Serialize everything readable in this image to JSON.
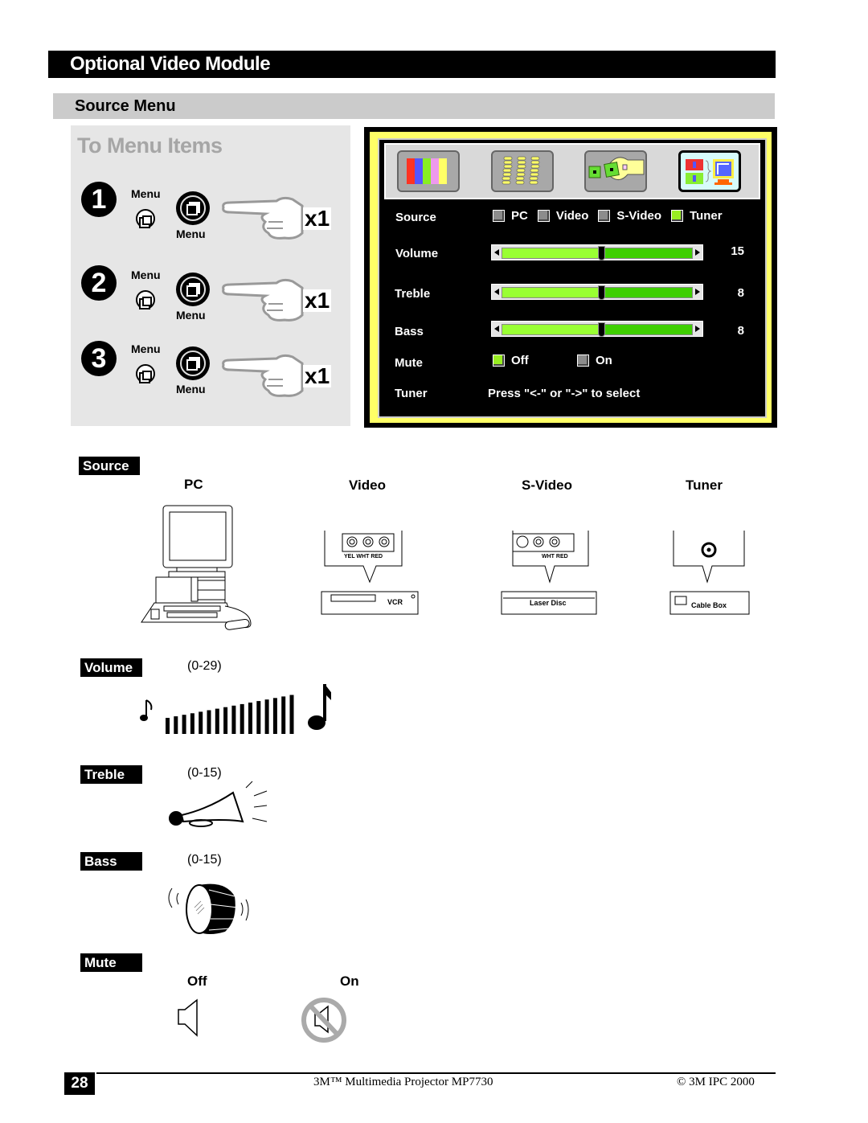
{
  "header": {
    "section_title": "Optional Video Module",
    "subsection_title": "Source Menu"
  },
  "instructions": {
    "title": "To Menu Items",
    "steps": [
      {
        "number": "1",
        "button_label_top": "Menu",
        "button_label_bottom": "Menu",
        "press_count": "x1"
      },
      {
        "number": "2",
        "button_label_top": "Menu",
        "button_label_bottom": "Menu",
        "press_count": "x1"
      },
      {
        "number": "3",
        "button_label_top": "Menu",
        "button_label_bottom": "Menu",
        "press_count": "x1"
      }
    ]
  },
  "osd": {
    "tabs": [
      {
        "icon": "color-bars-icon",
        "active": false
      },
      {
        "icon": "image-adjust-icon",
        "active": false
      },
      {
        "icon": "setup-wrench-icon",
        "active": false
      },
      {
        "icon": "source-select-icon",
        "active": true
      }
    ],
    "source": {
      "label": "Source",
      "options": [
        {
          "label": "PC",
          "selected": false
        },
        {
          "label": "Video",
          "selected": false
        },
        {
          "label": "S-Video",
          "selected": false
        },
        {
          "label": "Tuner",
          "selected": true
        }
      ]
    },
    "sliders": [
      {
        "label": "Volume",
        "value": "15",
        "fraction": 0.52
      },
      {
        "label": "Treble",
        "value": "8",
        "fraction": 0.52
      },
      {
        "label": "Bass",
        "value": "8",
        "fraction": 0.52
      }
    ],
    "mute": {
      "label": "Mute",
      "options": [
        {
          "label": "Off",
          "selected": true
        },
        {
          "label": "On",
          "selected": false
        }
      ]
    },
    "tuner": {
      "label": "Tuner",
      "hint": "Press \"<-\" or \"->\" to select"
    },
    "colors": {
      "frame_yellow": "#ffff66",
      "slider_fill": "#99ff33",
      "slider_track": "#3fcf00",
      "checkbox_on": "#99ee22",
      "checkbox_off": "#8c8c8c"
    }
  },
  "legend": {
    "source": {
      "tag": "Source",
      "items": [
        {
          "heading": "PC",
          "device": "computer"
        },
        {
          "heading": "Video",
          "device": "VCR",
          "jacks": "YEL WHT RED"
        },
        {
          "heading": "S-Video",
          "device": "Laser Disc",
          "jacks": "WHT RED"
        },
        {
          "heading": "Tuner",
          "device": "Cable Box"
        }
      ]
    },
    "volume": {
      "tag": "Volume",
      "range": "(0-29)"
    },
    "treble": {
      "tag": "Treble",
      "range": "(0-15)"
    },
    "bass": {
      "tag": "Bass",
      "range": "(0-15)"
    },
    "mute": {
      "tag": "Mute",
      "off_label": "Off",
      "on_label": "On"
    }
  },
  "footer": {
    "page_number": "28",
    "product": "3M™ Multimedia Projector MP7730",
    "copyright": "© 3M IPC 2000"
  }
}
